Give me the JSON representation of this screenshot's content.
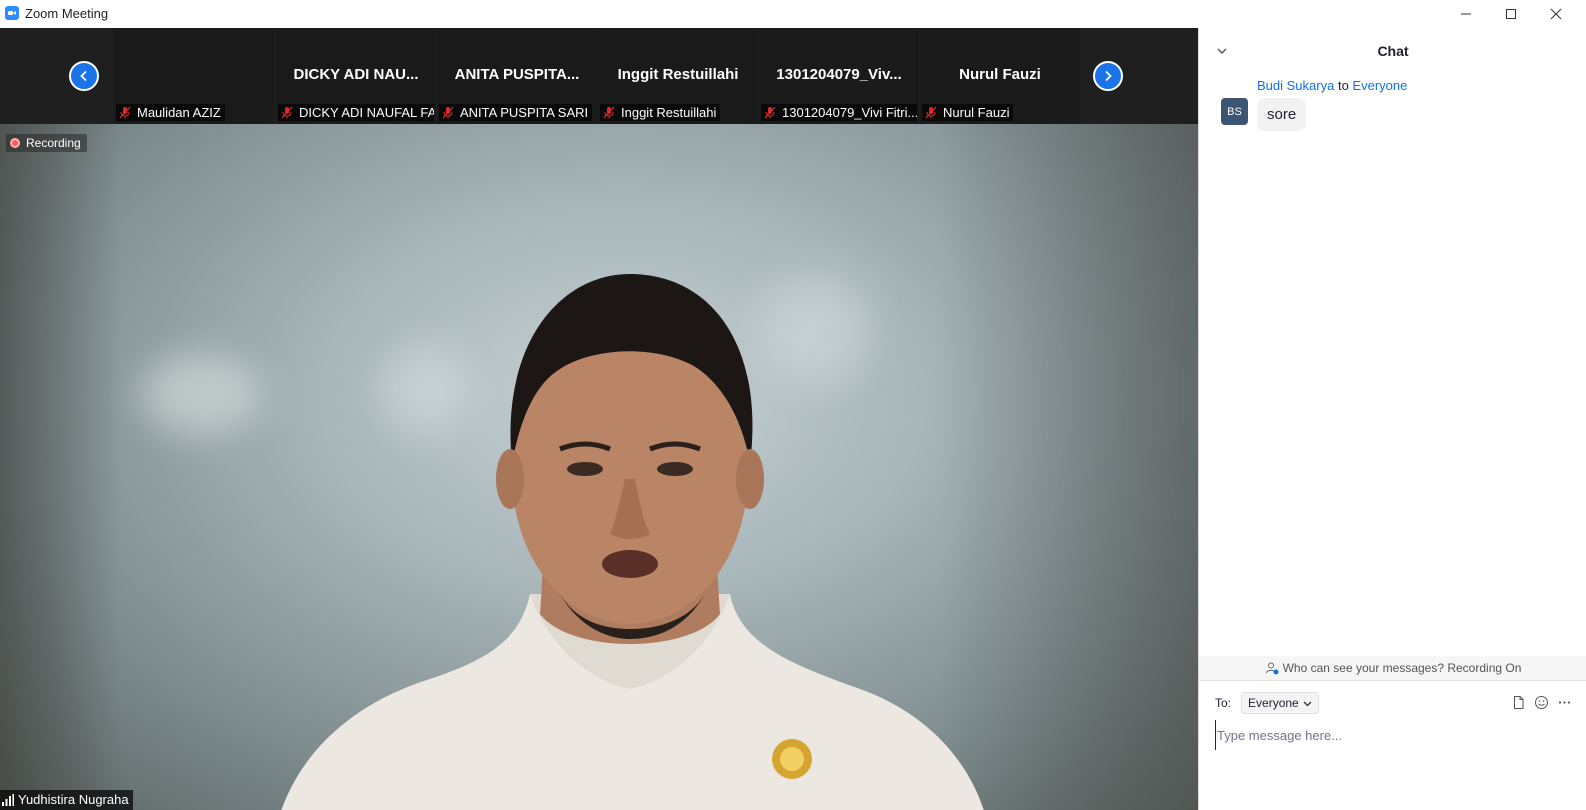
{
  "window": {
    "title": "Zoom Meeting",
    "icon": "zoom-camera-icon",
    "controls": [
      "minimize-icon",
      "maximize-icon",
      "close-icon"
    ]
  },
  "strip": {
    "prev_icon": "chevron-left-icon",
    "next_icon": "chevron-right-icon",
    "tiles": [
      {
        "display_name": "",
        "label": "Maulidan AZIZ",
        "muted": true
      },
      {
        "display_name": "DICKY ADI NAU...",
        "label": "DICKY ADI NAUFAL FA...",
        "muted": true
      },
      {
        "display_name": "ANITA PUSPITA...",
        "label": "ANITA PUSPITA SARI",
        "muted": true
      },
      {
        "display_name": "Inggit Restuillahi",
        "label": "Inggit Restuillahi",
        "muted": true
      },
      {
        "display_name": "1301204079_Viv...",
        "label": "1301204079_Vivi Fitri...",
        "muted": true
      },
      {
        "display_name": "Nurul Fauzi",
        "label": "Nurul Fauzi",
        "muted": true
      }
    ]
  },
  "main_video": {
    "recording_label": "Recording",
    "speaker_name": "Yudhistira Nugraha"
  },
  "chat": {
    "title": "Chat",
    "messages": [
      {
        "sender": "Budi Sukarya",
        "to_word": "to",
        "recipient": "Everyone",
        "avatar_initials": "BS",
        "text": "sore"
      }
    ],
    "privacy_notice": "Who can see your messages? Recording On",
    "to_label": "To:",
    "to_value": "Everyone",
    "input_placeholder": "Type message here...",
    "tool_icons": [
      "file-icon",
      "emoji-icon",
      "more-icon"
    ]
  },
  "colors": {
    "accent_blue": "#0e72ed",
    "nav_button_blue": "#1a73e8",
    "mute_red": "#e02828",
    "recording_red": "#ff5a5a",
    "avatar_bg": "#3b5572"
  }
}
